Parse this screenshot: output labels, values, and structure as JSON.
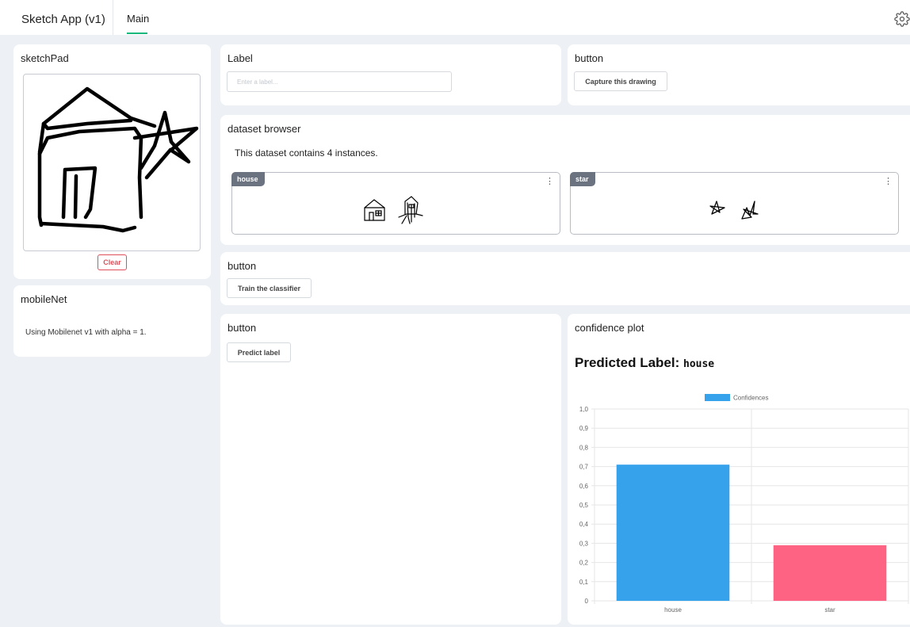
{
  "header": {
    "app_title": "Sketch App (v1)",
    "tab_main": "Main"
  },
  "sketchpad": {
    "title": "sketchPad",
    "clear_label": "Clear"
  },
  "mobilenet": {
    "title": "mobileNet",
    "text": "Using Mobilenet v1 with alpha = 1."
  },
  "label_panel": {
    "title": "Label",
    "placeholder": "Enter a label..."
  },
  "capture_panel": {
    "title": "button",
    "button_label": "Capture this drawing"
  },
  "dataset_browser": {
    "title": "dataset browser",
    "summary": "This dataset contains 4 instances.",
    "classes": [
      {
        "label": "house"
      },
      {
        "label": "star"
      }
    ]
  },
  "train_panel": {
    "title": "button",
    "button_label": "Train the classifier"
  },
  "predict_panel": {
    "title": "button",
    "button_label": "Predict label"
  },
  "confidence_plot": {
    "title": "confidence plot",
    "predicted_prefix": "Predicted Label:",
    "predicted_value": "house"
  },
  "chart_data": {
    "type": "bar",
    "categories": [
      "house",
      "star"
    ],
    "series": [
      {
        "name": "Confidences",
        "values": [
          0.71,
          0.29
        ]
      }
    ],
    "colors": [
      "#36a2eb",
      "#ff6384"
    ],
    "legend_color": "#36a2eb",
    "ylim": [
      0,
      1
    ],
    "yticks": [
      0,
      0.1,
      0.2,
      0.3,
      0.4,
      0.5,
      0.6,
      0.7,
      0.8,
      0.9,
      1
    ],
    "ytick_labels": [
      "0",
      "0,1",
      "0,2",
      "0,3",
      "0,4",
      "0,5",
      "0,6",
      "0,7",
      "0,8",
      "0,9",
      "1,0"
    ],
    "legend": "top",
    "grid": true
  }
}
